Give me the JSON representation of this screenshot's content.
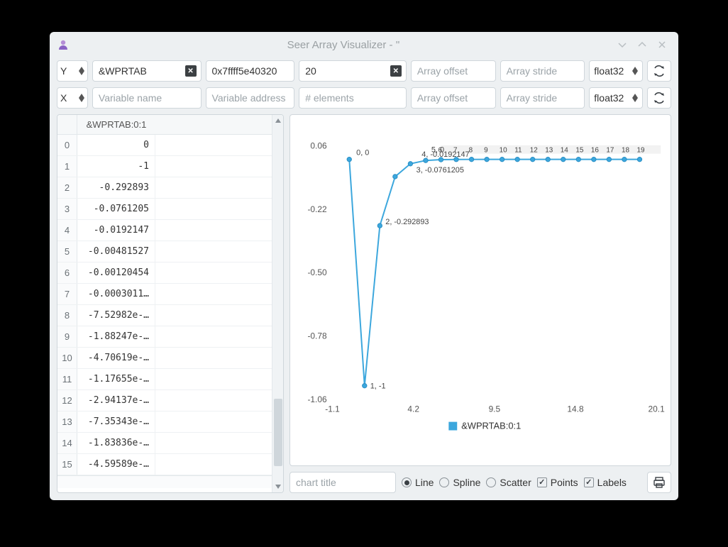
{
  "window": {
    "title": "Seer Array Visualizer - ''"
  },
  "rowY": {
    "axis": "Y",
    "name": "&WPRTAB",
    "addr": "0x7ffff5e40320",
    "count": "20",
    "offset_ph": "Array offset",
    "stride_ph": "Array stride",
    "dtype": "float32"
  },
  "rowX": {
    "axis": "X",
    "name_ph": "Variable name",
    "addr_ph": "Variable address",
    "count_ph": "# elements",
    "offset_ph": "Array offset",
    "stride_ph": "Array stride",
    "dtype": "float32"
  },
  "table": {
    "header": "&WPRTAB:0:1",
    "rows": [
      {
        "i": "0",
        "v": "0"
      },
      {
        "i": "1",
        "v": "-1"
      },
      {
        "i": "2",
        "v": "-0.292893"
      },
      {
        "i": "3",
        "v": "-0.0761205"
      },
      {
        "i": "4",
        "v": "-0.0192147"
      },
      {
        "i": "5",
        "v": "-0.00481527"
      },
      {
        "i": "6",
        "v": "-0.00120454"
      },
      {
        "i": "7",
        "v": "-0.0003011…"
      },
      {
        "i": "8",
        "v": "-7.52982e-…"
      },
      {
        "i": "9",
        "v": "-1.88247e-…"
      },
      {
        "i": "10",
        "v": "-4.70619e-…"
      },
      {
        "i": "11",
        "v": "-1.17655e-…"
      },
      {
        "i": "12",
        "v": "-2.94137e-…"
      },
      {
        "i": "13",
        "v": "-7.35343e-…"
      },
      {
        "i": "14",
        "v": "-1.83836e-…"
      },
      {
        "i": "15",
        "v": "-4.59589e-…"
      }
    ]
  },
  "chart_data": {
    "type": "line",
    "series_name": "&WPRTAB:0:1",
    "x": [
      0,
      1,
      2,
      3,
      4,
      5,
      6,
      7,
      8,
      9,
      10,
      11,
      12,
      13,
      14,
      15,
      16,
      17,
      18,
      19
    ],
    "y": [
      0,
      -1,
      -0.292893,
      -0.0761205,
      -0.0192147,
      -0.00481527,
      -0.00120454,
      -0.00030112,
      -7.52982e-05,
      -1.88247e-05,
      -4.70619e-06,
      -1.17655e-06,
      -2.94137e-07,
      -7.35343e-08,
      -1.83836e-08,
      -4.59589e-09,
      -1.14897e-09,
      -2.87244e-10,
      -7.18109e-11,
      -1.79527e-11
    ],
    "xlim": [
      -1.1,
      20.1
    ],
    "ylim": [
      -1.06,
      0.06
    ],
    "xticks": [
      -1.1,
      4.2,
      9.5,
      14.8,
      20.1
    ],
    "yticks": [
      0.06,
      -0.22,
      -0.5,
      -0.78,
      -1.06
    ],
    "point_labels": {
      "0": "0, 0",
      "1": "1, -1",
      "2": "2, -0.292893",
      "3": "3, -0.0761205",
      "4": "4, -0.0192147"
    },
    "xlabel": "",
    "ylabel": "",
    "title": ""
  },
  "footer": {
    "title_ph": "chart title",
    "mode_line": "Line",
    "mode_spline": "Spline",
    "mode_scatter": "Scatter",
    "opt_points": "Points",
    "opt_labels": "Labels"
  }
}
